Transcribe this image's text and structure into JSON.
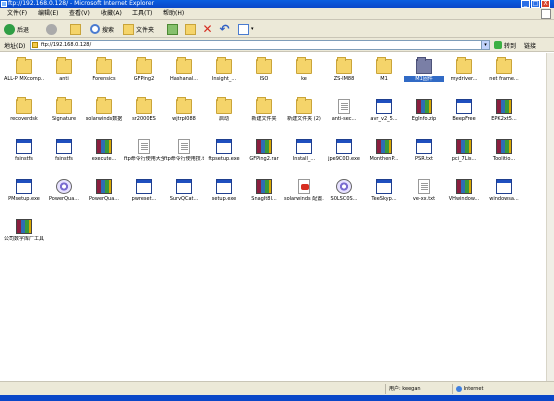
{
  "window": {
    "title": "ftp://192.168.0.128/ - Microsoft Internet Explorer",
    "minimize": "_",
    "maximize": "□",
    "close": "X"
  },
  "menu": [
    "文件(F)",
    "编辑(E)",
    "查看(V)",
    "收藏(A)",
    "工具(T)",
    "帮助(H)"
  ],
  "toolbar": {
    "back": "后退",
    "search": "搜索",
    "folders": "文件夹"
  },
  "address": {
    "label": "地址(D)",
    "url": "ftp://192.168.0.128/",
    "go": "转到",
    "links": "链接"
  },
  "items": [
    {
      "label": "ALL-P MXcomp...",
      "icon": "folder"
    },
    {
      "label": "anti",
      "icon": "folder"
    },
    {
      "label": "Forensics",
      "icon": "folder"
    },
    {
      "label": "GFPing2",
      "icon": "folder"
    },
    {
      "label": "Hashanal...",
      "icon": "folder"
    },
    {
      "label": "Insight_...",
      "icon": "folder"
    },
    {
      "label": "ISO",
      "icon": "folder"
    },
    {
      "label": "ke",
      "icon": "folder"
    },
    {
      "label": "ZS-IM88",
      "icon": "folder"
    },
    {
      "label": "M1",
      "icon": "folder"
    },
    {
      "label": "M1固件",
      "icon": "folder-dark",
      "selected": true
    },
    {
      "label": "mydriver...",
      "icon": "folder"
    },
    {
      "label": "net frame...",
      "icon": "folder"
    },
    {
      "label": "recoverdsk",
      "icon": "folder"
    },
    {
      "label": "Signature",
      "icon": "folder"
    },
    {
      "label": "solarwinds数据",
      "icon": "folder"
    },
    {
      "label": "sr2000ES",
      "icon": "folder"
    },
    {
      "label": "wjtrpI088",
      "icon": "folder"
    },
    {
      "label": "启动",
      "icon": "folder"
    },
    {
      "label": "新建文件夹",
      "icon": "folder"
    },
    {
      "label": "新建文件夹 (2)",
      "icon": "folder"
    },
    {
      "label": "anti-sec...",
      "icon": "textfile"
    },
    {
      "label": "avr_v2_5...",
      "icon": "window"
    },
    {
      "label": "EgInfo.zip",
      "icon": "archive"
    },
    {
      "label": "BeepFree",
      "icon": "window"
    },
    {
      "label": "EPK2xt5...",
      "icon": "archive"
    },
    {
      "label": "fsinstfs",
      "icon": "window"
    },
    {
      "label": "fsinstfs",
      "icon": "window"
    },
    {
      "label": "execute...",
      "icon": "archive"
    },
    {
      "label": "ftp命令行使用大全.txt",
      "icon": "textfile"
    },
    {
      "label": "ftp命令行使用技.txt",
      "icon": "textfile"
    },
    {
      "label": "ftpsetup.exe",
      "icon": "window"
    },
    {
      "label": "GFPing2.rar",
      "icon": "archive"
    },
    {
      "label": "Install_...",
      "icon": "window"
    },
    {
      "label": "jpe9C0D.exe",
      "icon": "window"
    },
    {
      "label": "MonthenP...",
      "icon": "archive"
    },
    {
      "label": "PSR.txt",
      "icon": "window"
    },
    {
      "label": "pci_7Lis...",
      "icon": "archive"
    },
    {
      "label": "Toolitio...",
      "icon": "archive"
    },
    {
      "label": "PMsetup.exe",
      "icon": "window"
    },
    {
      "label": "PowerQua...",
      "icon": "disc"
    },
    {
      "label": "PowerQua...",
      "icon": "archive"
    },
    {
      "label": "pwreset...",
      "icon": "window"
    },
    {
      "label": "SurvQCat...",
      "icon": "window"
    },
    {
      "label": "setup.exe",
      "icon": "window"
    },
    {
      "label": "SnagIt8I...",
      "icon": "archive"
    },
    {
      "label": "solarwinds 配置...",
      "icon": "pdf"
    },
    {
      "label": "S0LSC0S...",
      "icon": "disc"
    },
    {
      "label": "TeeSkyp...",
      "icon": "window"
    },
    {
      "label": "ve-xx.txt",
      "icon": "textfile"
    },
    {
      "label": "VHwindow...",
      "icon": "archive"
    },
    {
      "label": "windowsa...",
      "icon": "window"
    },
    {
      "label": "公司数字库厂工具.rar",
      "icon": "archive"
    }
  ],
  "status": {
    "user_label": "用户: keegan",
    "zone": "Internet"
  }
}
